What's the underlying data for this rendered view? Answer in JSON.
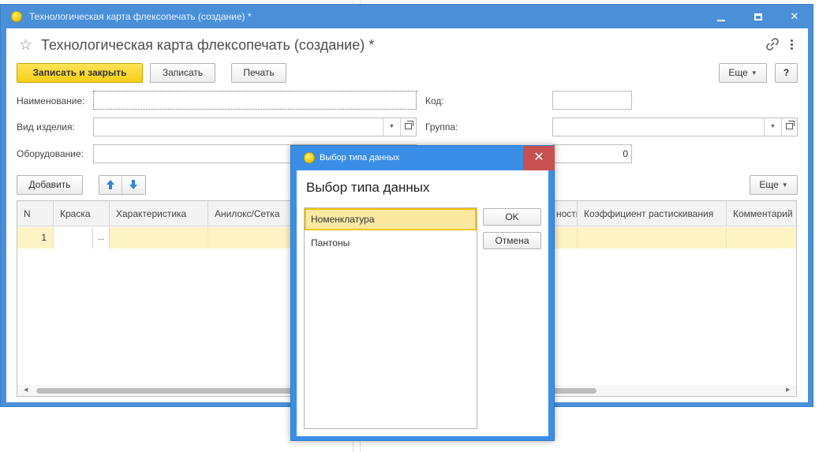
{
  "window": {
    "title": "Технологическая карта флексопечать (создание) *",
    "form_title": "Технологическая карта флексопечать (создание) *"
  },
  "toolbar": {
    "save_close_label": "Записать и закрыть",
    "save_label": "Записать",
    "print_label": "Печать",
    "more_label": "Еще",
    "help_label": "?"
  },
  "fields": {
    "name_label": "Наименование:",
    "name_value": "",
    "product_type_label": "Вид изделия:",
    "product_type_value": "",
    "equipment_label": "Оборудование:",
    "equipment_value": "",
    "code_label": "Код:",
    "code_value": "",
    "group_label": "Группа:",
    "group_value": "",
    "number_value": "0"
  },
  "table_toolbar": {
    "add_label": "Добавить",
    "more_label": "Еще"
  },
  "table": {
    "columns": [
      "N",
      "Краска",
      "Характеристика",
      "Анилокс/Сетка",
      "ность",
      "Коэффициент растискивания",
      "Комментарий"
    ],
    "rows": [
      {
        "n": "1",
        "paint": "",
        "paint_btn": "..."
      }
    ]
  },
  "dialog": {
    "title": "Выбор типа данных",
    "heading": "Выбор типа данных",
    "items": [
      "Номенклатура",
      "Пантоны"
    ],
    "selected_index": 0,
    "ok_label": "OK",
    "cancel_label": "Отмена",
    "close_glyph": "✕"
  }
}
